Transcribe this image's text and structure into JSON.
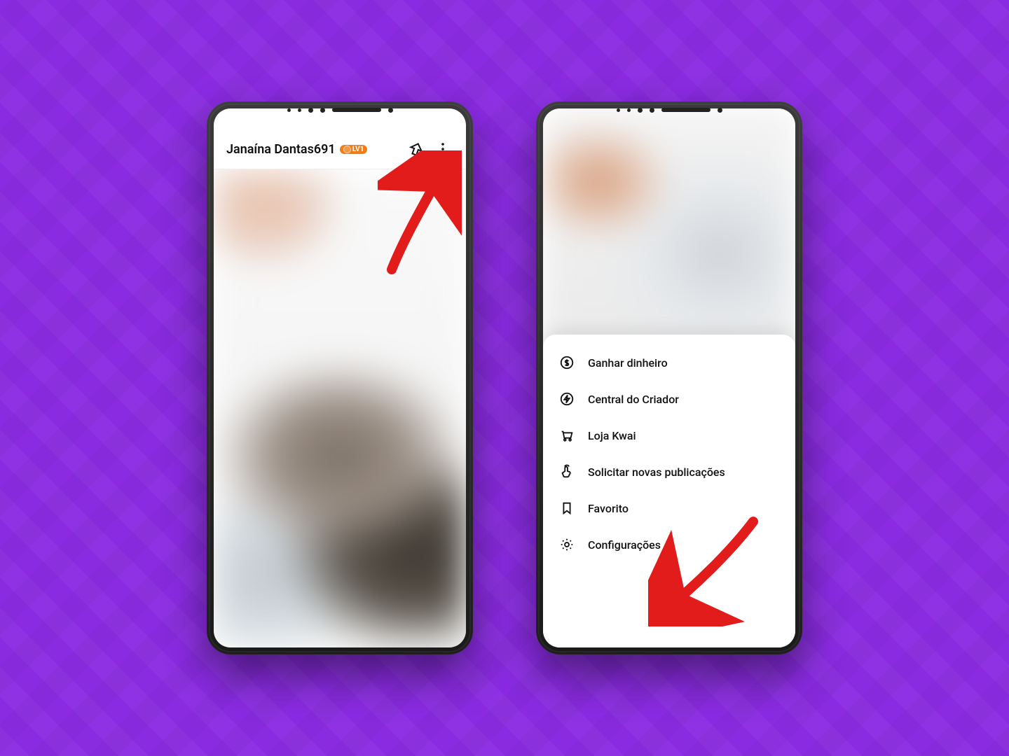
{
  "background": {
    "accent": "#8a2be2"
  },
  "phone1": {
    "header": {
      "username": "Janaína Dantas691",
      "level_badge": "LV1"
    }
  },
  "phone2": {
    "menu": {
      "items": [
        {
          "label": "Ganhar dinheiro",
          "icon": "dollar-icon"
        },
        {
          "label": "Central do Criador",
          "icon": "bolt-icon"
        },
        {
          "label": "Loja Kwai",
          "icon": "cart-icon"
        },
        {
          "label": "Solicitar novas publicações",
          "icon": "tap-icon"
        },
        {
          "label": "Favorito",
          "icon": "bookmark-icon"
        },
        {
          "label": "Configurações",
          "icon": "gear-icon"
        }
      ]
    }
  },
  "annotations": {
    "arrow1_target": "more-options",
    "arrow2_target": "settings-menu-item"
  }
}
